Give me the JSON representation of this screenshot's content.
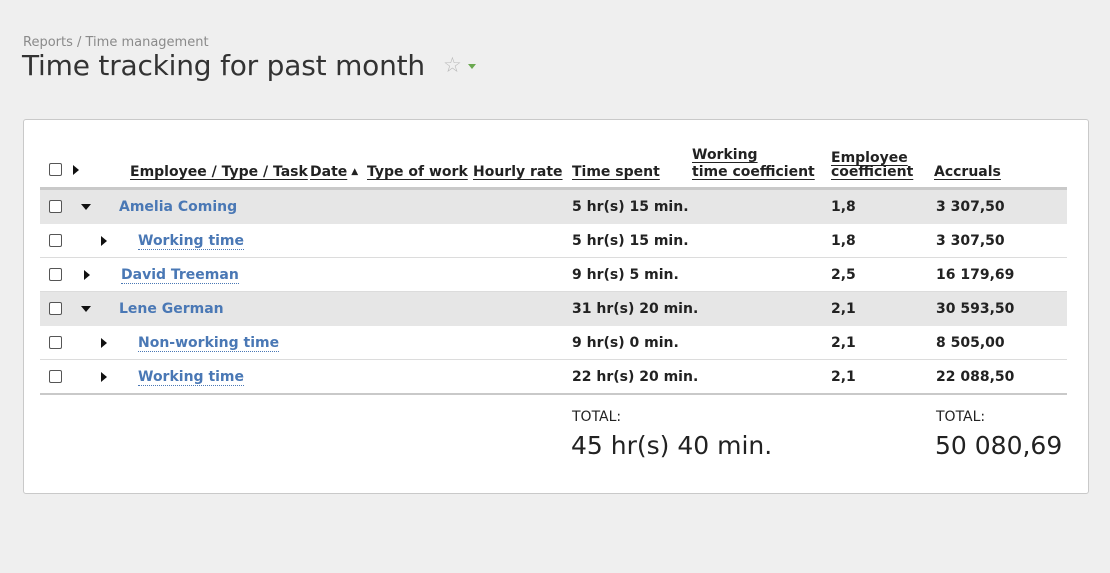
{
  "breadcrumb": "Reports / Time management",
  "title": "Time tracking for past month",
  "columns": {
    "employee": "Employee / Type / Task",
    "date": "Date",
    "type_of_work": "Type of work",
    "hourly_rate": "Hourly rate",
    "time_spent": "Time spent",
    "working_coef_1": "Working",
    "working_coef_2": "time coefficient",
    "employee_coef_1": "Employee",
    "employee_coef_2": "coefficient",
    "accruals": "Accruals"
  },
  "rows": [
    {
      "name": "Amelia Coming",
      "time": "5 hr(s) 15 min.",
      "coef": "1,8",
      "accruals": "3 307,50"
    },
    {
      "name": "Working time",
      "time": "5 hr(s) 15 min.",
      "coef": "1,8",
      "accruals": "3 307,50"
    },
    {
      "name": "David Treeman",
      "time": "9 hr(s) 5 min.",
      "coef": "2,5",
      "accruals": "16 179,69"
    },
    {
      "name": "Lene German",
      "time": "31 hr(s) 20 min.",
      "coef": "2,1",
      "accruals": "30 593,50"
    },
    {
      "name": "Non-working time",
      "time": "9 hr(s) 0 min.",
      "coef": "2,1",
      "accruals": "8 505,00"
    },
    {
      "name": "Working time",
      "time": "22 hr(s) 20 min.",
      "coef": "2,1",
      "accruals": "22 088,50"
    }
  ],
  "totals": {
    "label": "TOTAL:",
    "time": "45 hr(s) 40 min.",
    "accruals": "50 080,69"
  }
}
